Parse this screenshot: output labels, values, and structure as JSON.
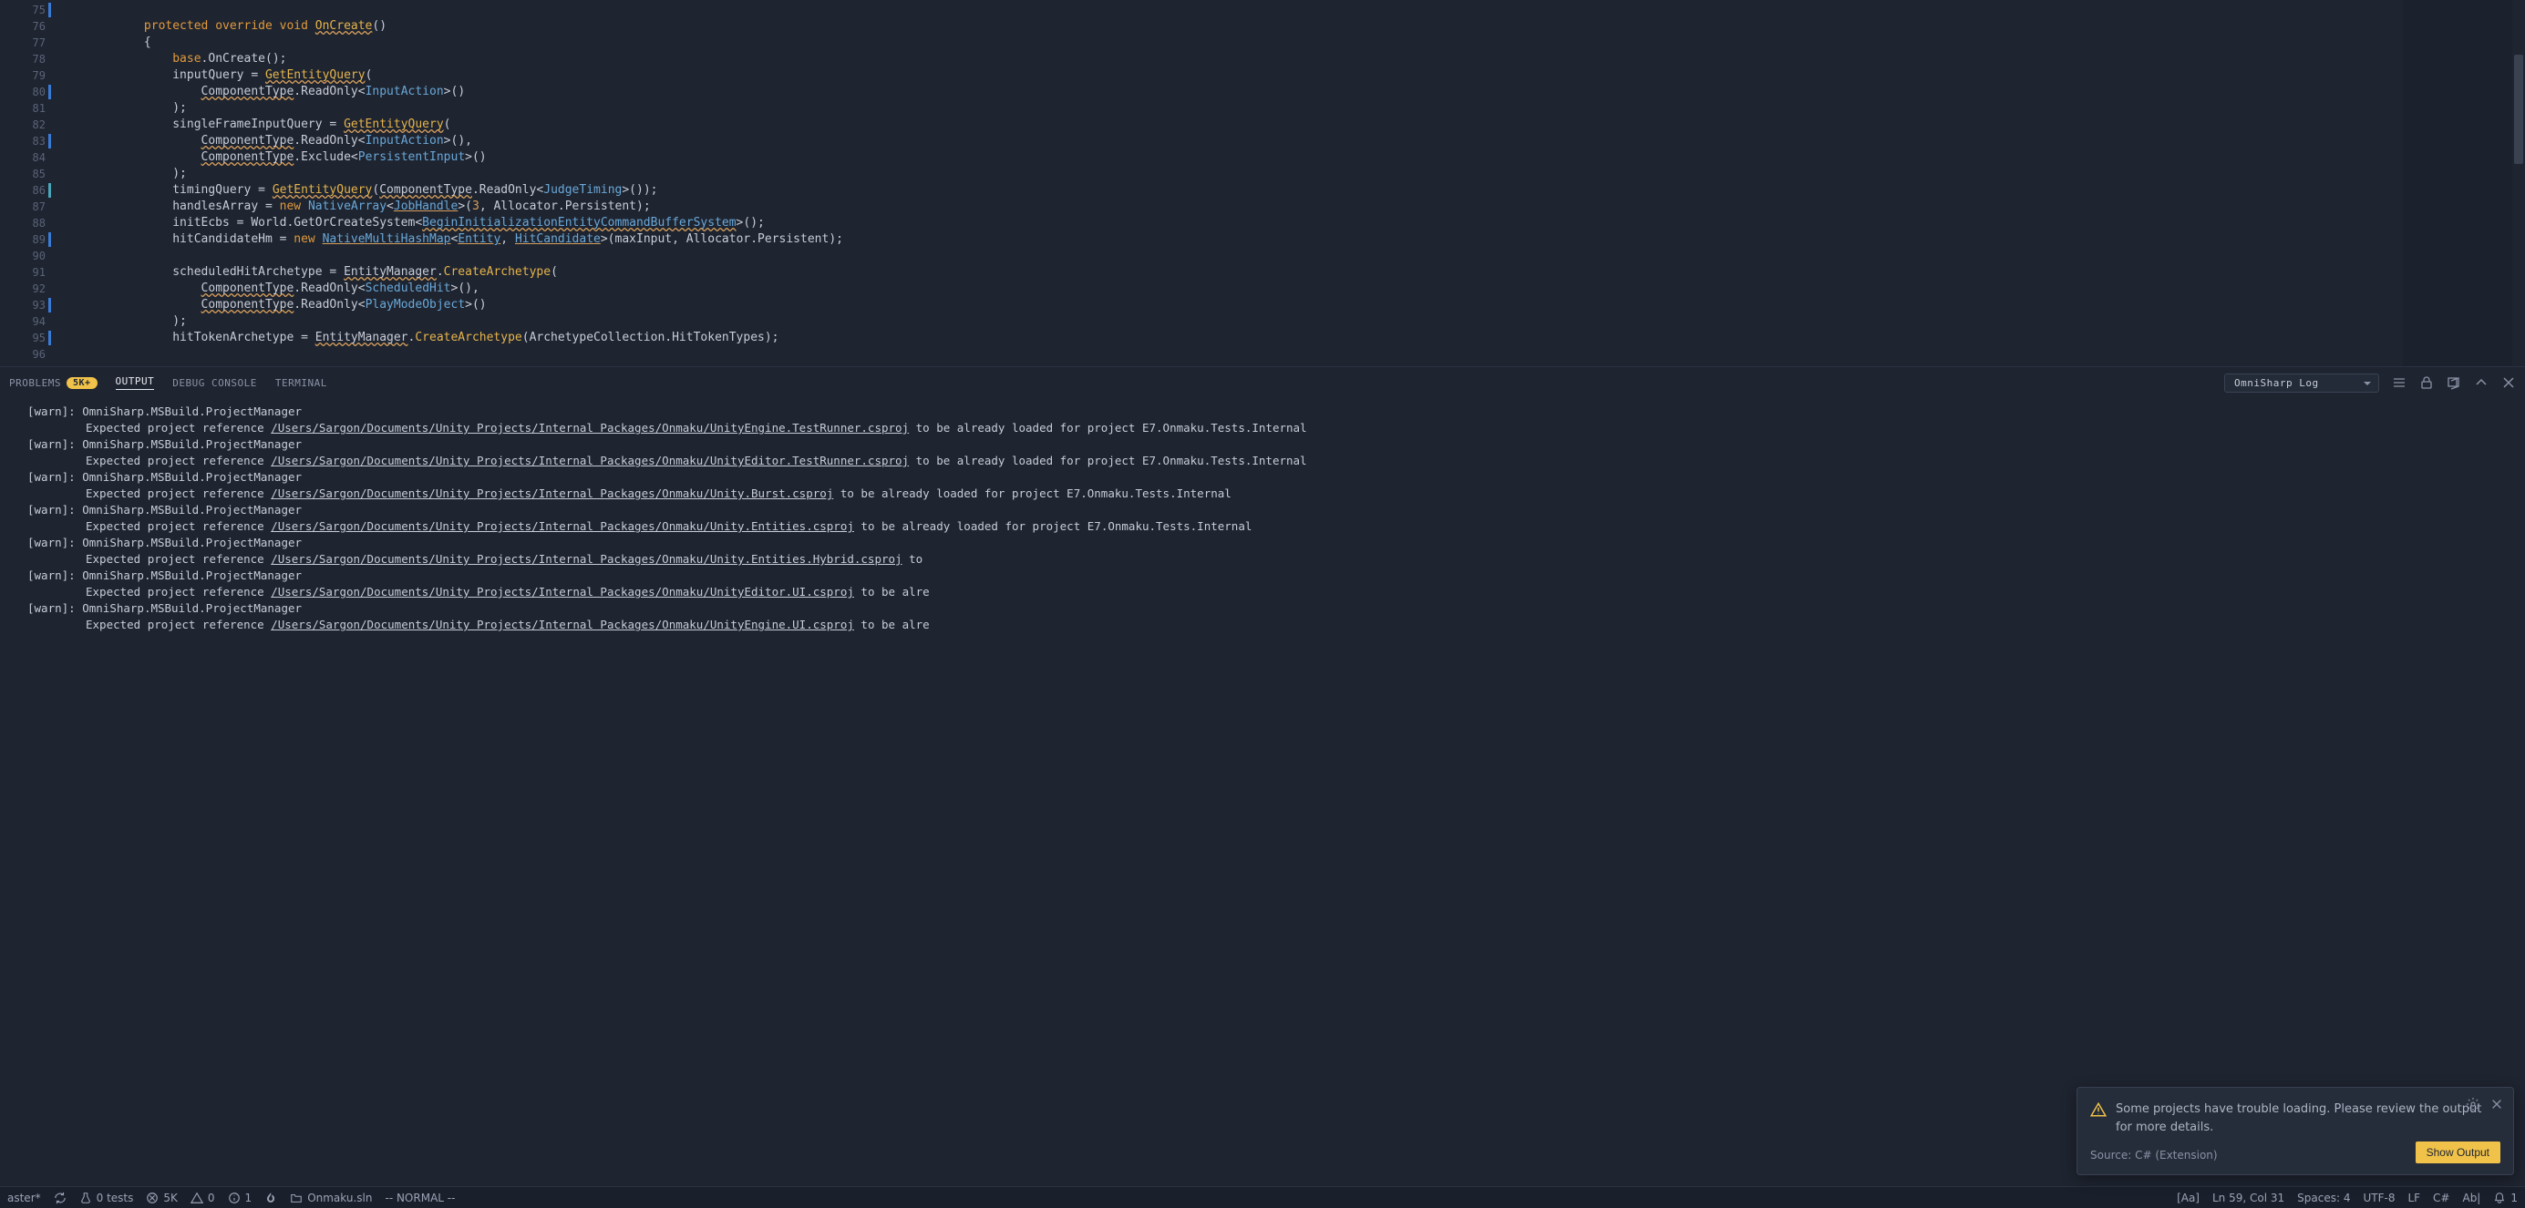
{
  "gutter": {
    "start": 75,
    "end": 96,
    "mod_bars": [
      75,
      80,
      83,
      86,
      89,
      93,
      95
    ],
    "cyan_bars": [
      86
    ]
  },
  "code": [
    [],
    [
      {
        "t": "            "
      },
      {
        "t": "protected override void",
        "c": "kw"
      },
      {
        "t": " "
      },
      {
        "t": "OnCreate",
        "c": "fn un"
      },
      {
        "t": "()"
      }
    ],
    [
      {
        "t": "            {"
      }
    ],
    [
      {
        "t": "                "
      },
      {
        "t": "base",
        "c": "kw"
      },
      {
        "t": ".OnCreate();"
      }
    ],
    [
      {
        "t": "                inputQuery = "
      },
      {
        "t": "GetEntityQuery",
        "c": "fn un"
      },
      {
        "t": "("
      }
    ],
    [
      {
        "t": "                    "
      },
      {
        "t": "ComponentType",
        "c": "un"
      },
      {
        "t": ".ReadOnly<"
      },
      {
        "t": "InputAction",
        "c": "type"
      },
      {
        "t": ">()"
      }
    ],
    [
      {
        "t": "                );"
      }
    ],
    [
      {
        "t": "                singleFrameInputQuery = "
      },
      {
        "t": "GetEntityQuery",
        "c": "fn un"
      },
      {
        "t": "("
      }
    ],
    [
      {
        "t": "                    "
      },
      {
        "t": "ComponentType",
        "c": "un"
      },
      {
        "t": ".ReadOnly<"
      },
      {
        "t": "InputAction",
        "c": "type"
      },
      {
        "t": ">(),"
      }
    ],
    [
      {
        "t": "                    "
      },
      {
        "t": "ComponentType",
        "c": "un"
      },
      {
        "t": ".Exclude<"
      },
      {
        "t": "PersistentInput",
        "c": "type"
      },
      {
        "t": ">()"
      }
    ],
    [
      {
        "t": "                );"
      }
    ],
    [
      {
        "t": "                timingQuery = "
      },
      {
        "t": "GetEntityQuery",
        "c": "fn un"
      },
      {
        "t": "("
      },
      {
        "t": "ComponentType",
        "c": "un"
      },
      {
        "t": ".ReadOnly<"
      },
      {
        "t": "JudgeTiming",
        "c": "type"
      },
      {
        "t": ">());"
      }
    ],
    [
      {
        "t": "                handlesArray = "
      },
      {
        "t": "new",
        "c": "new"
      },
      {
        "t": " "
      },
      {
        "t": "NativeArray",
        "c": "type"
      },
      {
        "t": "<"
      },
      {
        "t": "JobHandle",
        "c": "type ul"
      },
      {
        "t": ">("
      },
      {
        "t": "3",
        "c": "num"
      },
      {
        "t": ", Allocator.Persistent);"
      }
    ],
    [
      {
        "t": "                initEcbs = World.GetOrCreateSystem<"
      },
      {
        "t": "BeginInitializationEntityCommandBufferSystem",
        "c": "type un"
      },
      {
        "t": ">();"
      }
    ],
    [
      {
        "t": "                hitCandidateHm = "
      },
      {
        "t": "new",
        "c": "new"
      },
      {
        "t": " "
      },
      {
        "t": "NativeMultiHashMap",
        "c": "type ul"
      },
      {
        "t": "<"
      },
      {
        "t": "Entity",
        "c": "type ul"
      },
      {
        "t": ", "
      },
      {
        "t": "HitCandidate",
        "c": "type ul"
      },
      {
        "t": ">(maxInput, Allocator.Persistent);"
      }
    ],
    [],
    [
      {
        "t": "                scheduledHitArchetype = "
      },
      {
        "t": "EntityManager",
        "c": "un"
      },
      {
        "t": "."
      },
      {
        "t": "CreateArchetype",
        "c": "fn"
      },
      {
        "t": "("
      }
    ],
    [
      {
        "t": "                    "
      },
      {
        "t": "ComponentType",
        "c": "un"
      },
      {
        "t": ".ReadOnly<"
      },
      {
        "t": "ScheduledHit",
        "c": "type"
      },
      {
        "t": ">(),"
      }
    ],
    [
      {
        "t": "                    "
      },
      {
        "t": "ComponentType",
        "c": "un"
      },
      {
        "t": ".ReadOnly<"
      },
      {
        "t": "PlayModeObject",
        "c": "type"
      },
      {
        "t": ">()"
      }
    ],
    [
      {
        "t": "                );"
      }
    ],
    [
      {
        "t": "                hitTokenArchetype = "
      },
      {
        "t": "EntityManager",
        "c": "un"
      },
      {
        "t": "."
      },
      {
        "t": "CreateArchetype",
        "c": "fn"
      },
      {
        "t": "(ArchetypeCollection.HitTokenTypes);"
      }
    ],
    []
  ],
  "panel": {
    "tabs": {
      "problems": "PROBLEMS",
      "problems_badge": "5K+",
      "output": "OUTPUT",
      "debug": "DEBUG CONSOLE",
      "terminal": "TERMINAL"
    },
    "dropdown": "OmniSharp Log"
  },
  "output_lines": [
    {
      "prefix": "[warn]: ",
      "body": "OmniSharp.MSBuild.ProjectManager"
    },
    {
      "prefix": "",
      "body": "Expected project reference ",
      "path": "/Users/Sargon/Documents/Unity Projects/Internal Packages/Onmaku/UnityEngine.TestRunner.csproj",
      "tail": " to be already loaded for project E7.Onmaku.Tests.Internal"
    },
    {
      "prefix": "[warn]: ",
      "body": "OmniSharp.MSBuild.ProjectManager"
    },
    {
      "prefix": "",
      "body": "Expected project reference ",
      "path": "/Users/Sargon/Documents/Unity Projects/Internal Packages/Onmaku/UnityEditor.TestRunner.csproj",
      "tail": " to be already loaded for project E7.Onmaku.Tests.Internal"
    },
    {
      "prefix": "[warn]: ",
      "body": "OmniSharp.MSBuild.ProjectManager"
    },
    {
      "prefix": "",
      "body": "Expected project reference ",
      "path": "/Users/Sargon/Documents/Unity Projects/Internal Packages/Onmaku/Unity.Burst.csproj",
      "tail": " to be already loaded for project E7.Onmaku.Tests.Internal"
    },
    {
      "prefix": "[warn]: ",
      "body": "OmniSharp.MSBuild.ProjectManager"
    },
    {
      "prefix": "",
      "body": "Expected project reference ",
      "path": "/Users/Sargon/Documents/Unity Projects/Internal Packages/Onmaku/Unity.Entities.csproj",
      "tail": " to be already loaded for project E7.Onmaku.Tests.Internal"
    },
    {
      "prefix": "[warn]: ",
      "body": "OmniSharp.MSBuild.ProjectManager"
    },
    {
      "prefix": "",
      "body": "Expected project reference ",
      "path": "/Users/Sargon/Documents/Unity Projects/Internal Packages/Onmaku/Unity.Entities.Hybrid.csproj",
      "tail": " to"
    },
    {
      "prefix": "[warn]: ",
      "body": "OmniSharp.MSBuild.ProjectManager"
    },
    {
      "prefix": "",
      "body": "Expected project reference ",
      "path": "/Users/Sargon/Documents/Unity Projects/Internal Packages/Onmaku/UnityEditor.UI.csproj",
      "tail": " to be alre"
    },
    {
      "prefix": "[warn]: ",
      "body": "OmniSharp.MSBuild.ProjectManager"
    },
    {
      "prefix": "",
      "body": "Expected project reference ",
      "path": "/Users/Sargon/Documents/Unity Projects/Internal Packages/Onmaku/UnityEngine.UI.csproj",
      "tail": " to be alre"
    }
  ],
  "notification": {
    "message": "Some projects have trouble loading. Please review the output for more details.",
    "source": "Source: C# (Extension)",
    "button": "Show Output"
  },
  "status": {
    "branch": "aster*",
    "tests": "0 tests",
    "errors": "5K",
    "warnings": "0",
    "info": "1",
    "solution": "Onmaku.sln",
    "mode": "-- NORMAL --",
    "match_case": "[Aa]",
    "pos": "Ln 59, Col 31",
    "spaces": "Spaces: 4",
    "encoding": "UTF-8",
    "eol": "LF",
    "lang": "C#",
    "ab": "Ab|",
    "bell": "1"
  }
}
